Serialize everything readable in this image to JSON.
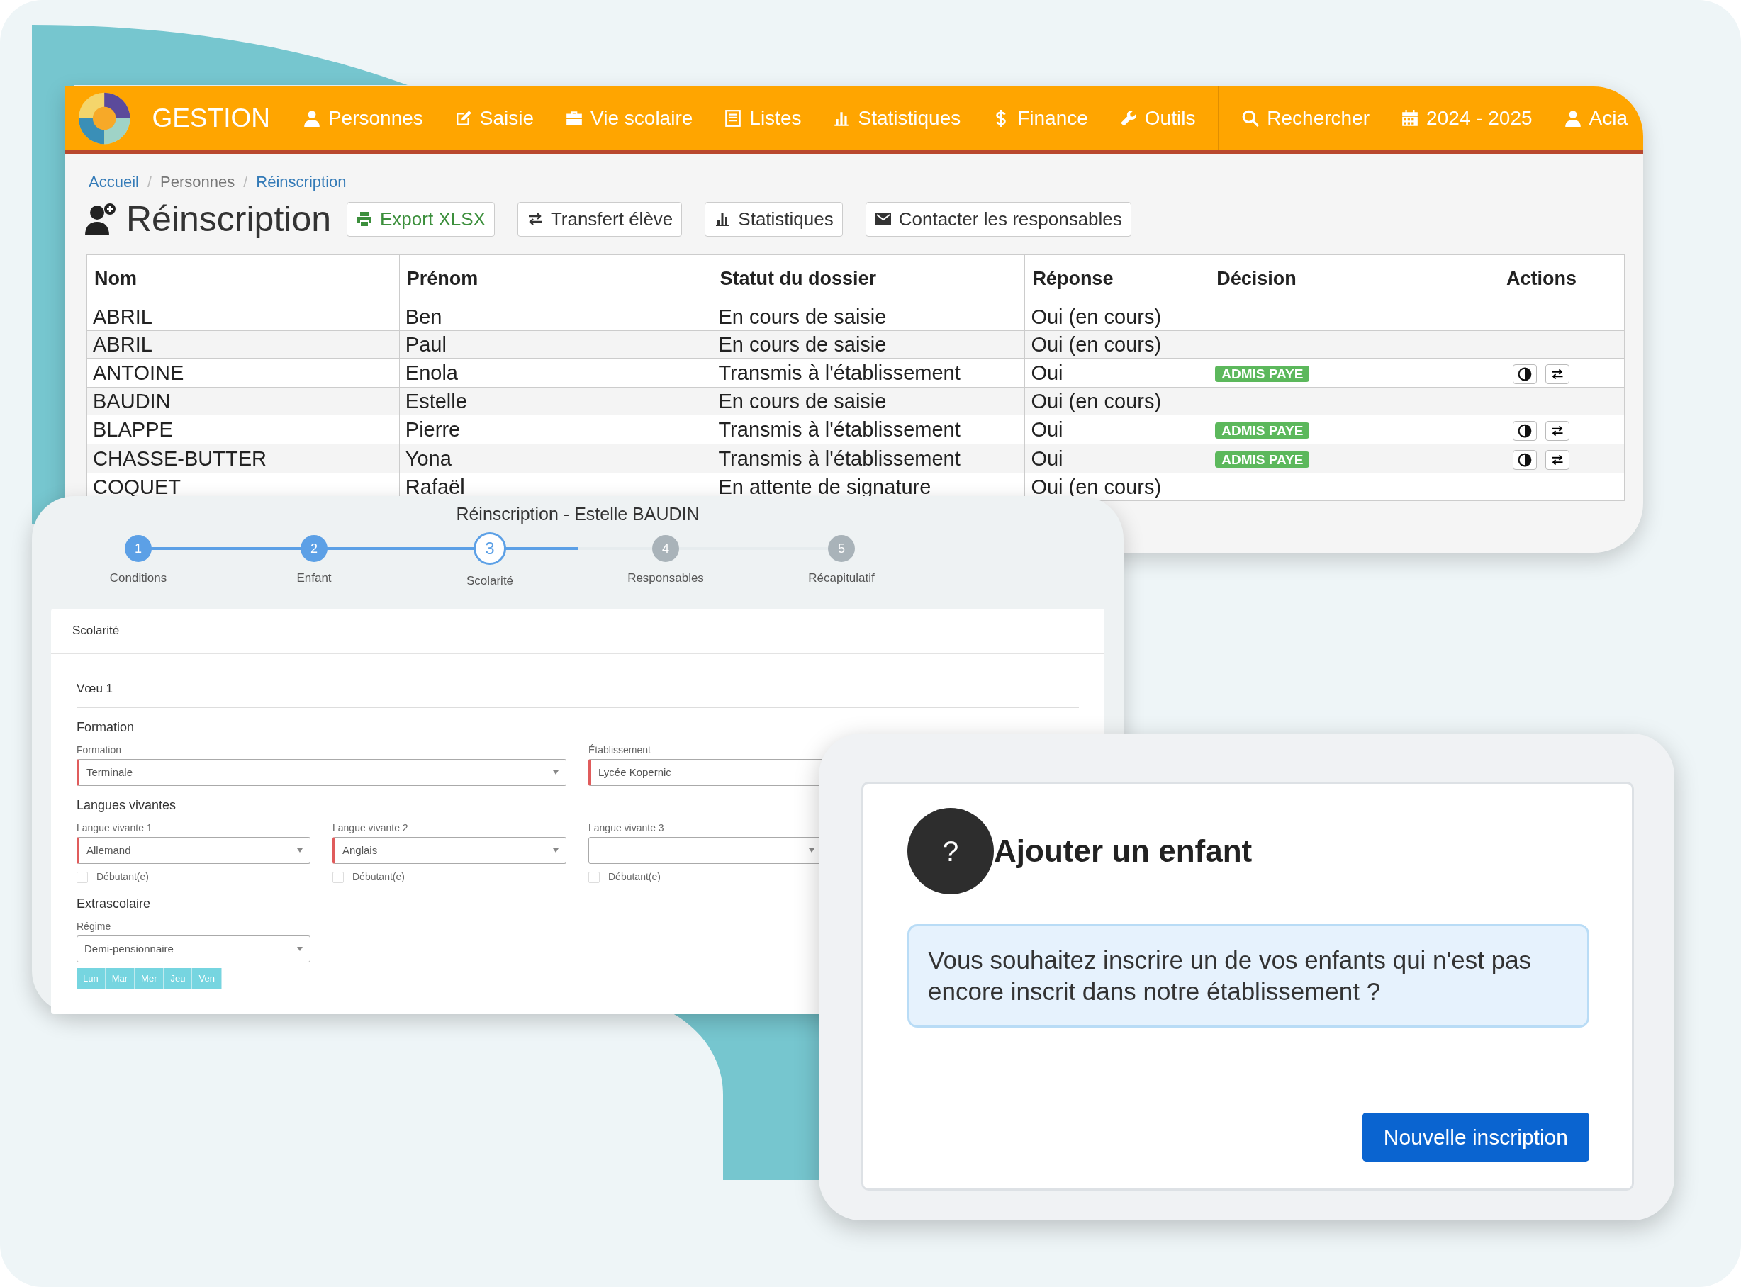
{
  "app": {
    "brand": "GESTION",
    "nav": [
      "Personnes",
      "Saisie",
      "Vie scolaire",
      "Listes",
      "Statistiques",
      "Finance",
      "Outils"
    ],
    "nav_right": [
      "Rechercher",
      "2024 - 2025",
      "Acia"
    ],
    "breadcrumb": [
      {
        "label": "Accueil",
        "kind": "link"
      },
      {
        "separator": "/",
        "label": "Personnes",
        "kind": "text"
      },
      {
        "separator": "/",
        "label": "Réinscription",
        "kind": "link"
      }
    ],
    "page_title": "Réinscription",
    "toolbar": [
      {
        "label": "Export XLSX",
        "kind": "success"
      },
      {
        "label": "Transfert élève",
        "kind": "default"
      },
      {
        "label": "Statistiques",
        "kind": "default"
      },
      {
        "label": "Contacter les responsables",
        "kind": "default"
      }
    ],
    "table": {
      "columns": [
        "Nom",
        "Prénom",
        "Statut du dossier",
        "Réponse",
        "Décision",
        "Actions"
      ],
      "rows": [
        {
          "nom": "ABRIL",
          "prenom": "Ben",
          "statut": "En cours de saisie",
          "reponse": "Oui (en cours)",
          "actions": false
        },
        {
          "nom": "ABRIL",
          "prenom": "Paul",
          "statut": "En cours de saisie",
          "reponse": "Oui (en cours)",
          "actions": false
        },
        {
          "nom": "ANTOINE",
          "prenom": "Enola",
          "statut": "Transmis à l'établissement",
          "reponse": "Oui",
          "decision": "ADMIS PAYE",
          "actions": true
        },
        {
          "nom": "BAUDIN",
          "prenom": "Estelle",
          "statut": "En cours de saisie",
          "reponse": "Oui (en cours)",
          "actions": false
        },
        {
          "nom": "BLAPPE",
          "prenom": "Pierre",
          "statut": "Transmis à l'établissement",
          "reponse": "Oui",
          "decision": "ADMIS PAYE",
          "actions": true
        },
        {
          "nom": "CHASSE-BUTTER",
          "prenom": "Yona",
          "statut": "Transmis à l'établissement",
          "reponse": "Oui",
          "decision": "ADMIS PAYE",
          "actions": true
        },
        {
          "nom": "COQUET",
          "prenom": "Rafaël",
          "statut": "En attente de signature",
          "reponse": "Oui (en cours)",
          "actions": false
        }
      ]
    }
  },
  "wizard": {
    "title": "Réinscription - Estelle BAUDIN",
    "steps": [
      {
        "number": "1",
        "label": "Conditions",
        "completed": true,
        "selected": false
      },
      {
        "number": "2",
        "label": "Enfant",
        "completed": true,
        "selected": false
      },
      {
        "number": "3",
        "label": "Scolarité",
        "completed": false,
        "selected": true
      },
      {
        "number": "4",
        "label": "Responsables",
        "completed": false,
        "selected": false
      },
      {
        "number": "5",
        "label": "Récapitulatif",
        "completed": false,
        "selected": false
      }
    ],
    "card_title": "Scolarité",
    "wish": "Vœu 1",
    "sections": [
      {
        "heading": "Formation",
        "fields": [
          {
            "label": "Formation",
            "value": "Terminale",
            "kind": "select",
            "required": true
          },
          {
            "label": "Établissement",
            "value": "Lycée Kopernic",
            "kind": "text",
            "required": true
          }
        ]
      },
      {
        "heading": "Langues vivantes",
        "fields": [
          {
            "label": "Langue vivante 1",
            "value": "Allemand",
            "kind": "select",
            "required": true,
            "checkbox": {
              "label": "Débutant(e)",
              "checked": false
            }
          },
          {
            "label": "Langue vivante 2",
            "value": "Anglais",
            "kind": "select",
            "required": true,
            "checkbox": {
              "label": "Débutant(e)",
              "checked": false
            }
          },
          {
            "label": "Langue vivante 3",
            "kind": "select",
            "required": false,
            "checkbox": {
              "label": "Débutant(e)",
              "checked": false
            }
          }
        ]
      },
      {
        "heading": "Extrascolaire",
        "fields": [
          {
            "label": "Régime",
            "value": "Demi-pensionnaire",
            "kind": "select",
            "required": false,
            "days": [
              "Lun",
              "Mar",
              "Mer",
              "Jeu",
              "Ven"
            ]
          }
        ]
      }
    ]
  },
  "dialog": {
    "icon_text": "?",
    "title": "Ajouter un enfant",
    "message": "Vous souhaitez inscrire un de vos enfants qui n'est pas encore inscrit dans notre établissement ?",
    "button": "Nouvelle inscription"
  }
}
